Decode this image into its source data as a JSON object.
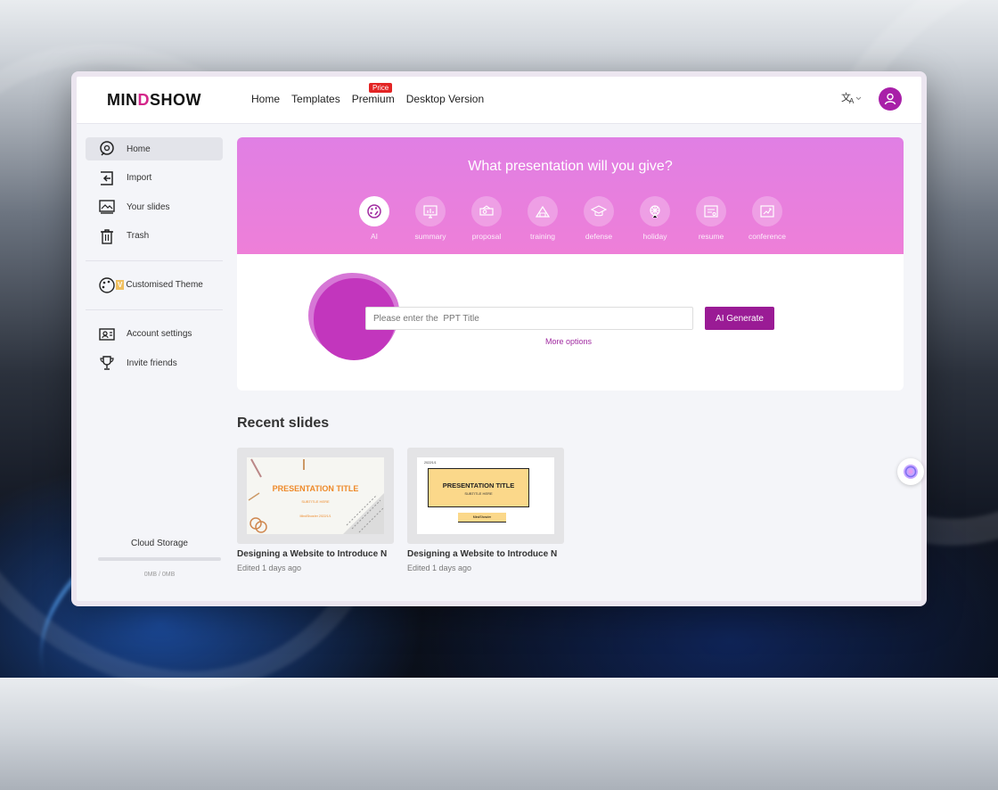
{
  "header": {
    "logo_prefix": "MIN",
    "logo_mark": "D",
    "logo_suffix": "SHOW",
    "nav": [
      "Home",
      "Templates",
      "Premium",
      "Desktop Version"
    ],
    "premium_badge": "Price",
    "language_icon": "translate-icon",
    "avatar_icon": "user-icon",
    "accent_color": "#a81fa8"
  },
  "sidebar": {
    "items": [
      {
        "label": "Home",
        "icon": "home-icon"
      },
      {
        "label": "Import",
        "icon": "import-icon"
      },
      {
        "label": "Your slides",
        "icon": "slides-icon"
      },
      {
        "label": "Trash",
        "icon": "trash-icon"
      }
    ],
    "theme_item": {
      "label": "Customised Theme",
      "icon": "palette-icon",
      "badge": "V"
    },
    "account_items": [
      {
        "label": "Account settings",
        "icon": "account-icon"
      },
      {
        "label": "Invite friends",
        "icon": "trophy-icon"
      }
    ],
    "storage": {
      "label": "Cloud Storage",
      "value": "0MB / 0MB"
    }
  },
  "hero": {
    "title": "What presentation will you give?",
    "categories": [
      {
        "label": "AI",
        "icon": "ai-palette-icon"
      },
      {
        "label": "summary",
        "icon": "summary-icon"
      },
      {
        "label": "proposal",
        "icon": "proposal-icon"
      },
      {
        "label": "training",
        "icon": "training-icon"
      },
      {
        "label": "defense",
        "icon": "graduation-cap-icon"
      },
      {
        "label": "holiday",
        "icon": "holiday-icon"
      },
      {
        "label": "resume",
        "icon": "resume-icon"
      },
      {
        "label": "conference",
        "icon": "conference-icon"
      }
    ],
    "input_placeholder": "Please enter the  PPT Title",
    "generate_label": "AI Generate",
    "more_options": "More options"
  },
  "recent": {
    "title": "Recent slides",
    "cards": [
      {
        "name": "Designing a Website to Introduce N",
        "edited": "Edited 1 days ago",
        "slide_title": "PRESENTATION TITLE",
        "slide_subtitle": "SUBTITLE HERE",
        "slide_footer": "MindShow/er 2022/1/1"
      },
      {
        "name": "Designing a Website to Introduce N",
        "edited": "Edited 1 days ago",
        "slide_title": "PRESENTATION TITLE",
        "slide_subtitle": "SUBTITLE HERE",
        "slide_tag": "2022/1/1",
        "slide_footer": "MindShow/er"
      }
    ]
  },
  "assistant_icon": "assistant-orb-icon"
}
